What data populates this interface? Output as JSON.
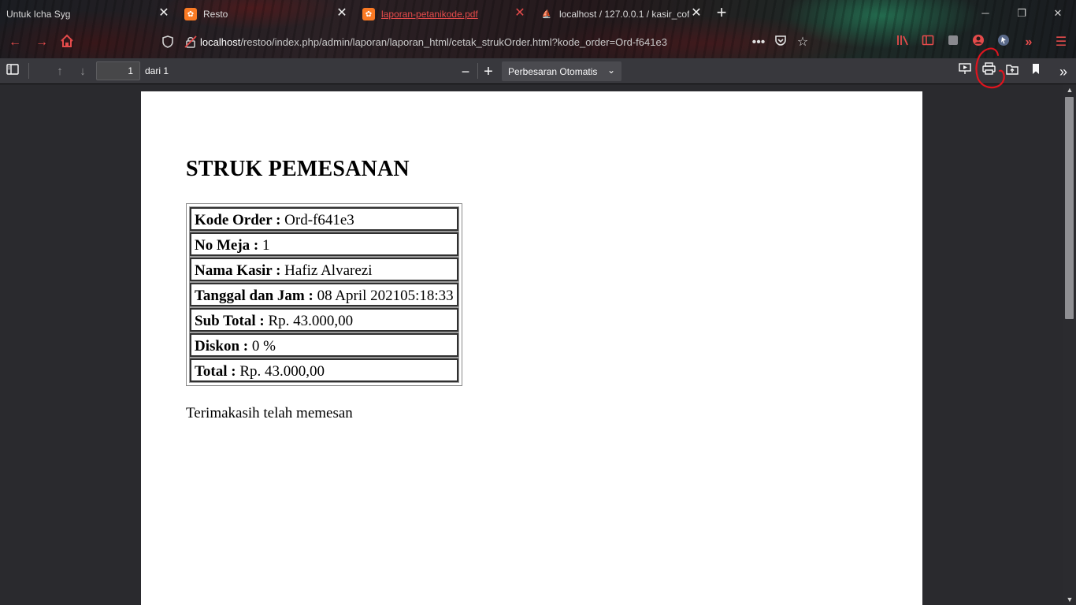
{
  "browser": {
    "tabs": [
      {
        "title": "Untuk Icha Syg",
        "favicon": "none"
      },
      {
        "title": "Resto",
        "favicon": "xampp-icon"
      },
      {
        "title": "laporan-petanikode.pdf",
        "favicon": "xampp-icon",
        "active": true
      },
      {
        "title": "localhost / 127.0.0.1 / kasir_cof",
        "favicon": "phpmyadmin-icon"
      }
    ],
    "new_tab_glyph": "+",
    "close_glyph": "✕",
    "url": {
      "host": "localhost",
      "path": "/restoo/index.php/admin/laporan/laporan_html/cetak_strukOrder.html?kode_order=Ord-f641e3"
    },
    "accent_color": "#e54b4b"
  },
  "pdf_toolbar": {
    "page_number": "1",
    "page_of": "dari 1",
    "zoom": "Perbesaran Otomatis"
  },
  "document": {
    "title": "STRUK PEMESANAN",
    "rows": [
      {
        "label": "Kode Order :",
        "value": "Ord-f641e3"
      },
      {
        "label": "No Meja :",
        "value": "1"
      },
      {
        "label": "Nama Kasir :",
        "value": "Hafiz Alvarezi"
      },
      {
        "label": "Tanggal dan Jam :",
        "value": "08 April 202105:18:33"
      },
      {
        "label": "Sub Total :",
        "value": "Rp. 43.000,00"
      },
      {
        "label": "Diskon :",
        "value": "0 %"
      },
      {
        "label": "Total :",
        "value": "Rp. 43.000,00"
      }
    ],
    "footer": "Terimakasih telah memesan"
  }
}
